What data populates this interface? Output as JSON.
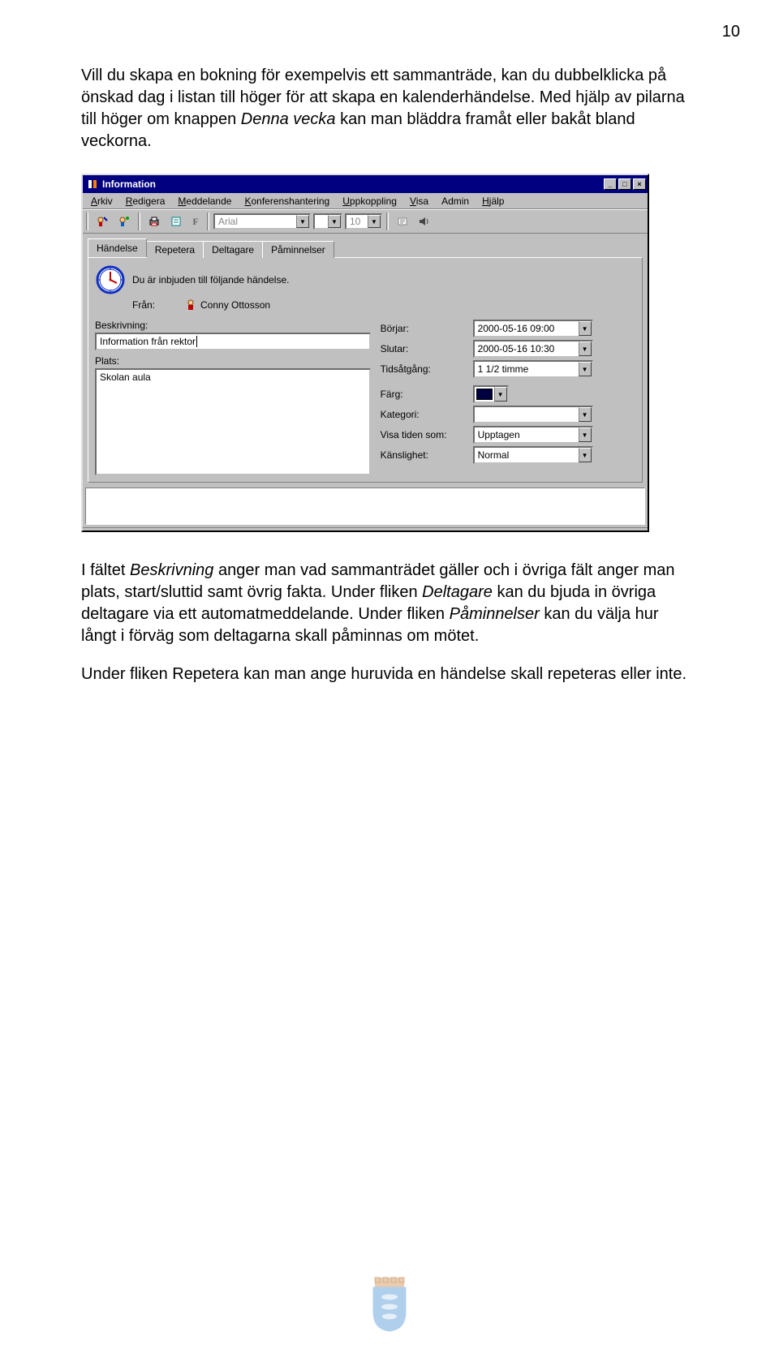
{
  "page_number": "10",
  "paragraphs": {
    "p1a": "Vill du skapa en bokning för exempelvis ett sammanträde, kan du dubbelklicka på önskad dag i listan till höger för att skapa en kalenderhändelse. Med hjälp av pilarna till höger om knappen ",
    "p1_italic1": "Denna vecka",
    "p1b": " kan man bläddra framåt eller bakåt bland veckorna.",
    "p2a": "I fältet ",
    "p2_italic1": "Beskrivning",
    "p2b": " anger man vad sammanträdet gäller och i övriga fält anger man plats, start/sluttid samt övrig fakta. Under fliken ",
    "p2_italic2": "Deltagare",
    "p2c": " kan du bjuda in övriga deltagare via ett automatmeddelande. Under fliken ",
    "p2_italic3": "Påminnelser",
    "p2d": " kan du välja hur långt i förväg som deltagarna skall påminnas om mötet.",
    "p3": "Under fliken Repetera kan man ange huruvida en händelse skall repeteras eller inte."
  },
  "window": {
    "title": "Information",
    "menus": [
      "Arkiv",
      "Redigera",
      "Meddelande",
      "Konferenshantering",
      "Uppkoppling",
      "Visa",
      "Admin",
      "Hjälp"
    ],
    "toolbar": {
      "font": "Arial",
      "font_size": "10",
      "f_label": "F"
    },
    "tabs": [
      "Händelse",
      "Repetera",
      "Deltagare",
      "Påminnelser"
    ],
    "top_line": "Du är inbjuden till följande händelse.",
    "from_label": "Från:",
    "from_value": "Conny Ottosson",
    "left": {
      "beskrivning_label": "Beskrivning:",
      "beskrivning_value": "Information från rektor",
      "plats_label": "Plats:",
      "plats_value": "Skolan aula"
    },
    "right": {
      "borjar_label": "Börjar:",
      "borjar_value": "2000-05-16 09:00",
      "slutar_label": "Slutar:",
      "slutar_value": "2000-05-16 10:30",
      "tidsatgang_label": "Tidsåtgång:",
      "tidsatgang_value": "1 1/2 timme",
      "farg_label": "Färg:",
      "kategori_label": "Kategori:",
      "kategori_value": "",
      "visa_label": "Visa tiden som:",
      "visa_value": "Upptagen",
      "kanslighet_label": "Känslighet:",
      "kanslighet_value": "Normal"
    }
  }
}
